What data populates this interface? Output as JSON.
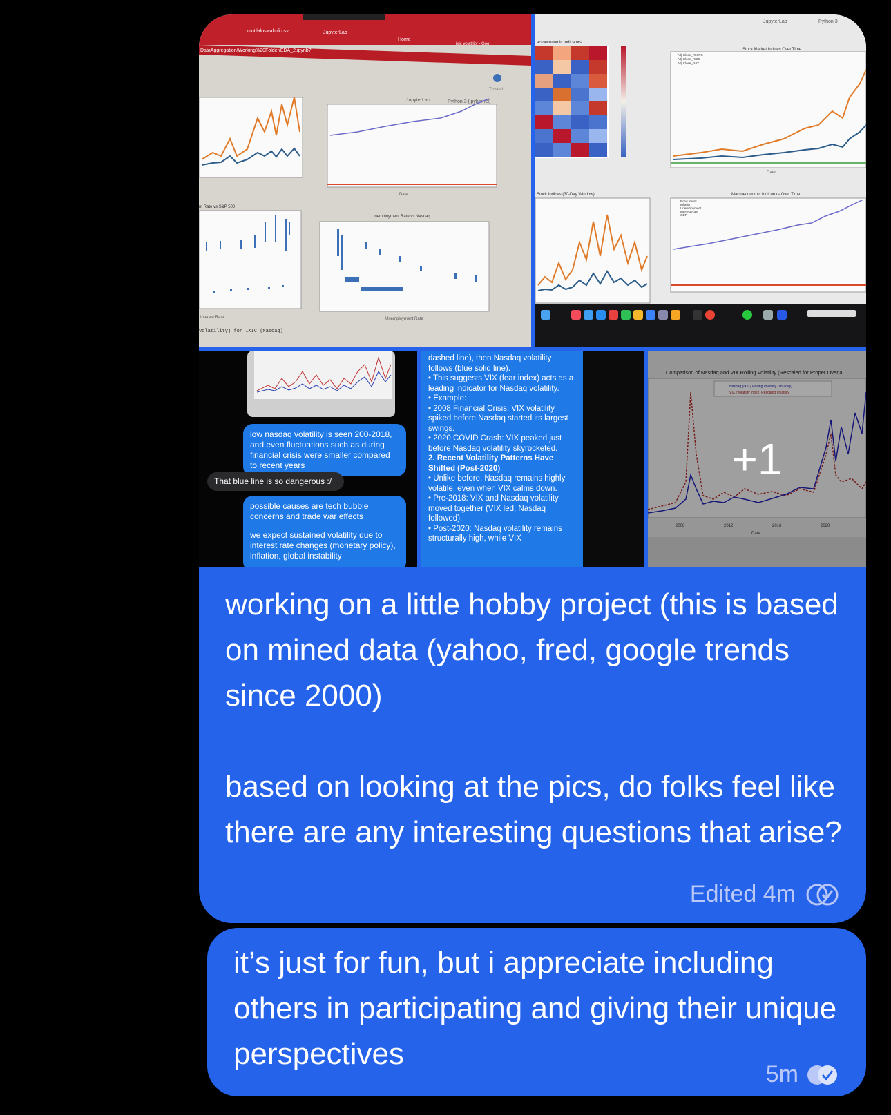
{
  "album": {
    "more_count": "+1",
    "tile1": {
      "tabs": [
        "motilaloswalmfi.csv",
        "JupyterLab",
        "Home",
        "ixic volatility - Goo"
      ],
      "address": "DataAggregation/Working%20Folder/EDA_2.ipynb?",
      "jupyter": "JupyterLab",
      "kernel": "Python 3 (ipykernel)",
      "trusted": "Trusted",
      "chart1_title": "Unemployment Rate vs Nasdaq",
      "chart2_title": "nt Rate vs S&P 500",
      "x_date": "Date",
      "y_value": "Value",
      "x_unemp": "Unemployment Rate",
      "x_interest": "Interest Rate",
      "code_line": "volatility) for IXIC (Nasdaq)"
    },
    "tile2": {
      "jupyter": "JupyterLab",
      "kernel": "Python 3",
      "heatmap_title": "acroeconomic Indicators",
      "chart_title": "Stock Market Indices Over Time",
      "legend": [
        "Adj Close_^GSPC",
        "Adj Close_^IXIC",
        "Adj Close_^VIX"
      ],
      "bottom_left_title": "Stock Indices (30-Day Window)",
      "bottom_right_title": "Macroeconomic Indicators Over Time",
      "legend2": [
        "Bond Yields",
        "Inflation",
        "Unemployment",
        "Interest Rate",
        "GDP"
      ],
      "x_date": "Date"
    },
    "tile3": {
      "msg1": "low nasdaq volatility is seen 200-2018, and even fluctuations such as during financial crisis were smaller compared to recent years",
      "msg2": "That blue line is so dangerous :/",
      "msg3a": "possible causes are tech bubble concerns and trade war effects",
      "msg3b": "we expect sustained volatility due to interest rate changes (monetary policy), inflation, global instability"
    },
    "tile4": {
      "lines": [
        "dashed line), then Nasdaq volatility follows (blue solid line).",
        "• This suggests VIX (fear index) acts as a leading indicator for Nasdaq volatility.",
        "• Example:",
        "• 2008 Financial Crisis: VIX volatility spiked before Nasdaq started its largest swings.",
        "• 2020 COVID Crash: VIX peaked just before Nasdaq volatility skyrocketed.",
        "2. Recent Volatility Patterns Have Shifted (Post-2020)",
        "• Unlike before, Nasdaq remains highly volatile, even when VIX calms down.",
        "• Pre-2018: VIX and Nasdaq volatility moved together (VIX led, Nasdaq followed).",
        "• Post-2020: Nasdaq volatility remains structurally high, while VIX"
      ]
    },
    "tile5": {
      "title": "Comparison of Nasdaq and VIX Rolling Volatility (Rescaled for Proper Overla",
      "legend": [
        "Nasdaq (IXIC) Rolling Volatility (180-day)",
        "VIX (Volatility Index) Rescaled Volatility"
      ],
      "x_ticks": [
        "2008",
        "2012",
        "2016",
        "2020"
      ],
      "x_label": "Date"
    }
  },
  "message1": {
    "text": "working on a little hobby project (this is based on mined data (yahoo, fred, google trends since 2000)\n\nbased on looking at the pics, do folks feel like there are any interesting questions that arise?",
    "meta": "Edited 4m"
  },
  "message2": {
    "text": "it’s just for fun, but i appreciate including others in participating and giving their unique perspectives",
    "meta": "5m"
  },
  "colors": {
    "bubble": "#2563eb",
    "background": "#000000",
    "meta": "#b9c8f7"
  }
}
